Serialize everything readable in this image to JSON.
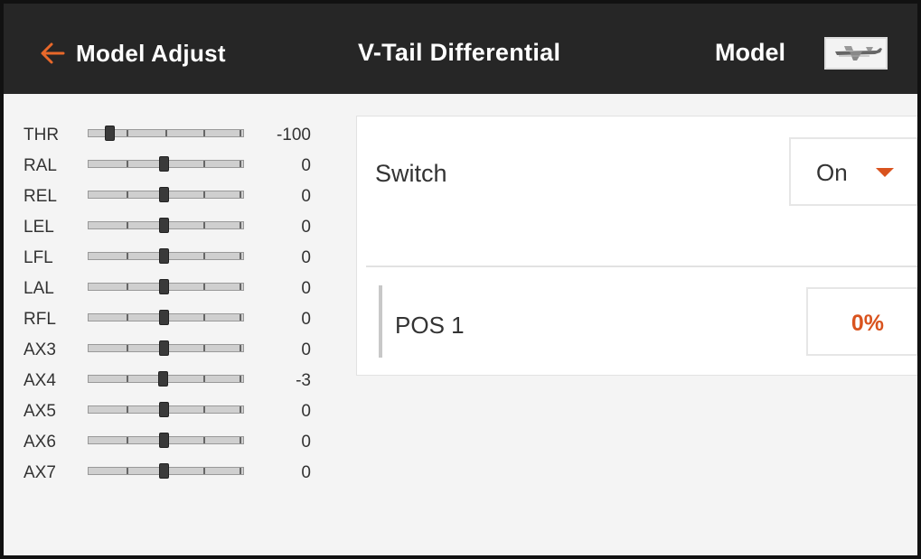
{
  "header": {
    "back_label": "Model Adjust",
    "title": "V-Tail Differential",
    "model_label": "Model"
  },
  "channels": [
    {
      "name": "THR",
      "value": "-100",
      "position": -100
    },
    {
      "name": "RAL",
      "value": "0",
      "position": 0
    },
    {
      "name": "REL",
      "value": "0",
      "position": 0
    },
    {
      "name": "LEL",
      "value": "0",
      "position": 0
    },
    {
      "name": "LFL",
      "value": "0",
      "position": 0
    },
    {
      "name": "LAL",
      "value": "0",
      "position": 0
    },
    {
      "name": "RFL",
      "value": "0",
      "position": 0
    },
    {
      "name": "AX3",
      "value": "0",
      "position": 0
    },
    {
      "name": "AX4",
      "value": "-3",
      "position": -3
    },
    {
      "name": "AX5",
      "value": "0",
      "position": 0
    },
    {
      "name": "AX6",
      "value": "0",
      "position": 0
    },
    {
      "name": "AX7",
      "value": "0",
      "position": 0
    }
  ],
  "settings": {
    "switch_label": "Switch",
    "switch_value": "On",
    "pos_label": "POS 1",
    "pos_value": "0%"
  },
  "colors": {
    "header_bg": "#262626",
    "accent": "#d9531e"
  }
}
